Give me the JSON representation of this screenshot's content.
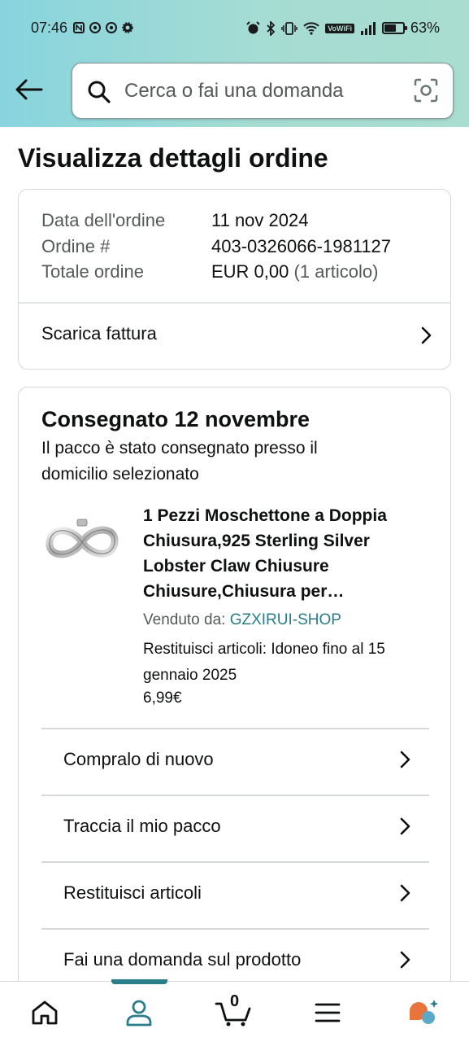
{
  "status_bar": {
    "time": "07:46",
    "battery_percent": "63%",
    "battery_level": 0.63,
    "wifi_badge": "VoWiFi"
  },
  "search": {
    "placeholder": "Cerca o fai una domanda"
  },
  "page_title": "Visualizza dettagli ordine",
  "order_summary": {
    "date_label": "Data dell'ordine",
    "date_value": "11 nov 2024",
    "number_label": "Ordine #",
    "number_value": "403-0326066-1981127",
    "total_label": "Totale ordine",
    "total_value": "EUR 0,00",
    "total_items": "(1 articolo)",
    "invoice_label": "Scarica fattura"
  },
  "shipment": {
    "status": "Consegnato 12 novembre",
    "description": "Il pacco è stato consegnato presso il domicilio selezionato",
    "product_title": "1 Pezzi Moschettone a Doppia Chiusura,925 Sterling Silver Lobster Claw Chiusure Chiusure,Chiusura per Collana,Bracciale",
    "sold_by_label": "Venduto da:",
    "seller": "GZXIRUI-SHOP",
    "returns_text": "Restituisci articoli: Idoneo fino al 15 gennaio 2025",
    "price": "6,99€",
    "actions": [
      {
        "label": "Compralo di nuovo"
      },
      {
        "label": "Traccia il mio pacco"
      },
      {
        "label": "Restituisci articoli"
      },
      {
        "label": "Fai una domanda sul prodotto"
      }
    ]
  },
  "bottom_nav": {
    "cart_count": "0",
    "active": "account"
  },
  "colors": {
    "accent": "#2a7d8a",
    "header_gradient_start": "#88d4de",
    "header_gradient_end": "#a8ddd0",
    "ai_orange": "#e8743b",
    "ai_blue": "#5aa9c8"
  }
}
